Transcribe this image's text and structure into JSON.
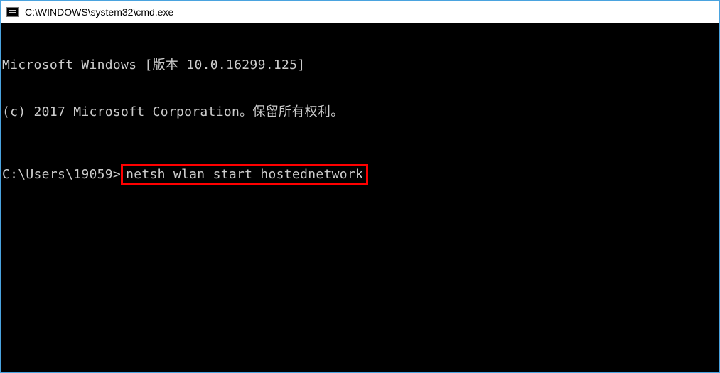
{
  "window": {
    "title": "C:\\WINDOWS\\system32\\cmd.exe"
  },
  "terminal": {
    "line1": "Microsoft Windows [版本 10.0.16299.125]",
    "line2": "(c) 2017 Microsoft Corporation。保留所有权利。",
    "prompt": "C:\\Users\\19059>",
    "command": "netsh wlan start hostednetwork"
  }
}
